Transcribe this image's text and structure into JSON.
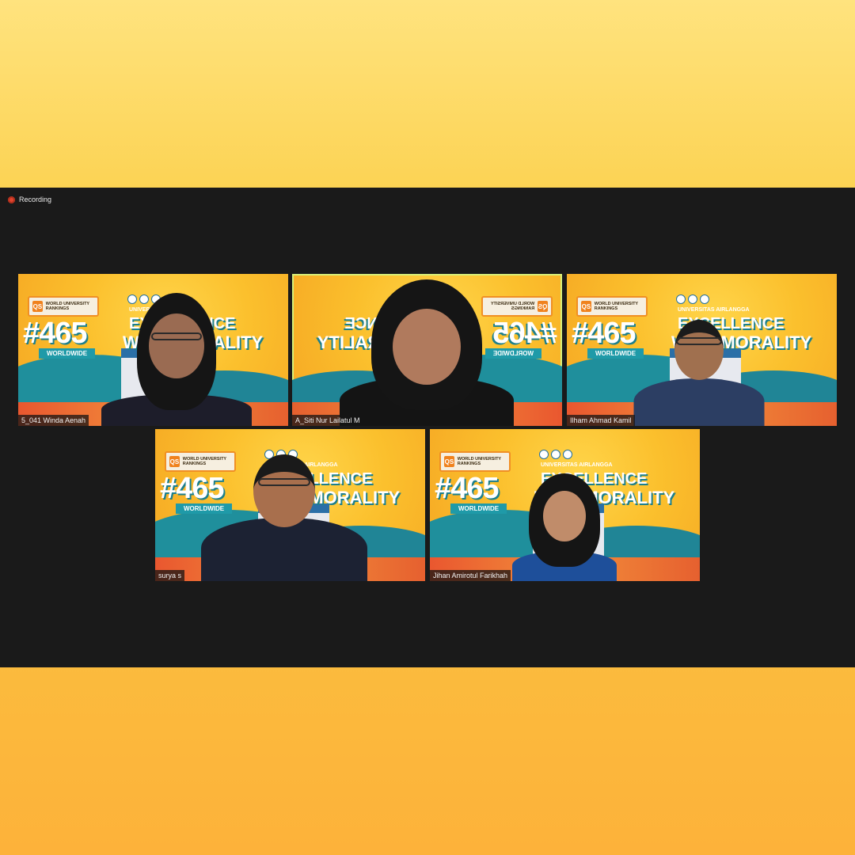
{
  "recording": {
    "label": "Recording",
    "icon": "record-dot-icon"
  },
  "background_art": {
    "qs_logo": "QS",
    "qs_text": "WORLD UNIVERSITY RANKINGS",
    "rank": "#465",
    "rank_sub": "WORLDWIDE",
    "university": "UNIVERSITAS AIRLANGGA",
    "slogan_line1": "EXCELLENCE",
    "slogan_line2": "WITH MORALITY"
  },
  "participants": [
    {
      "name": "5_041 Winda Aenah",
      "active": false
    },
    {
      "name": "A_Siti Nur Lailatul M",
      "active": true
    },
    {
      "name": "Ilham Ahmad Kamil",
      "active": false
    },
    {
      "name": "surya s",
      "active": false
    },
    {
      "name": "Jihan Amirotul Farikhah",
      "active": false
    }
  ],
  "colors": {
    "meeting_bg": "#1a1a1a",
    "active_border": "#d7f079",
    "recording_dot": "#e0452f"
  }
}
